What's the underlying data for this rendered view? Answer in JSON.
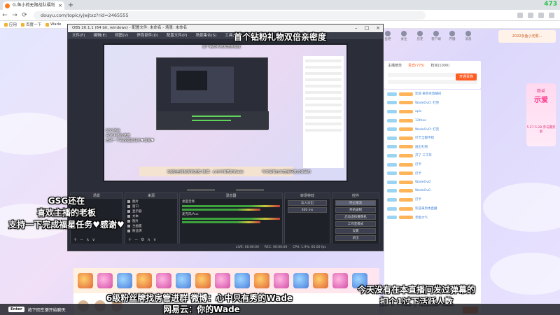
{
  "browser": {
    "tab_title": "G.鱼小荷无限战队福利",
    "url": "douyu.com/topic/yjwjtxz?rid=2465555",
    "score": "473",
    "bookmarks": [
      "应用",
      "百度一下",
      "Wade"
    ]
  },
  "douyu": {
    "nav": [
      "鱼吧",
      "关注",
      "历史",
      "客户端",
      "开播",
      "消息"
    ],
    "promo_top": "2022永鱼小无限...",
    "rank_tabs": [
      "主播榜单",
      "贵宾(775)",
      "粉丝(1000)"
    ],
    "follow_label": "开通贵族",
    "chat_messages": [
      "欢迎 来到本直播间",
      "WadeOvO: 打完",
      "apis",
      "12thao",
      "WadeOvO: 打完",
      "打卡全都不错",
      "送出礼物",
      "开了 三千年",
      "打卡",
      "打卡",
      "WadeOvO",
      "WadeOvO",
      "打卡",
      "欢迎来到本直播",
      "老板大气"
    ],
    "side_promo_title": "粉丝",
    "side_promo_big": "示爱",
    "side_promo_sub": "5.27-5.28 参与赢奖励"
  },
  "obs": {
    "title": "OBS 26.1.1 (64 bit, windows) - 配置文件: 未命名 - 场景: 未命名",
    "menu": [
      "文件(F)",
      "编辑(E)",
      "视图(V)",
      "停靠部件(D)",
      "配置文件(P)",
      "场景集合(S)",
      "工具(T)",
      "帮助(H)"
    ],
    "docks": {
      "scenes": "场景",
      "sources": "来源",
      "mixer": "混音器",
      "transitions": "转场特效",
      "controls": "控件"
    },
    "sources": [
      "图片",
      "窗口",
      "显示器",
      "文本",
      "图片",
      "主画面",
      "粉丝牌"
    ],
    "mixer_tracks": [
      "桌面音频",
      "麦克风/Aux"
    ],
    "controls": [
      "停止推流",
      "开始录制",
      "启动虚拟摄像机",
      "工作室模式",
      "设置",
      "退出"
    ],
    "footer": [
      "LIVE: 00:00:00",
      "REC: 00:00:00",
      "CPU: 1.9%, 60.00 fps"
    ]
  },
  "captions": {
    "top": "首个钻粉礼物双倍亲密度",
    "left_line1": "GSG还在",
    "left_line2": "喜欢主播的老板",
    "left_line3": "支持一下完成福星任务♥感谢♥",
    "bottom_line1": "6级粉丝牌找房管进群    微博：心中只有秀的Wade",
    "bottom_line2": "网易云：你的Wade",
    "right_line1": "今天没有在本直播间发过弹幕的",
    "right_line2": "扣个1过下活跃人数"
  },
  "taskbar": {
    "key": "Enter",
    "text": "按下回车键开始聊天"
  },
  "colors": {
    "accent": "#ff5d23",
    "obs_bg": "#2b2e38",
    "score": "#2ec24a"
  }
}
